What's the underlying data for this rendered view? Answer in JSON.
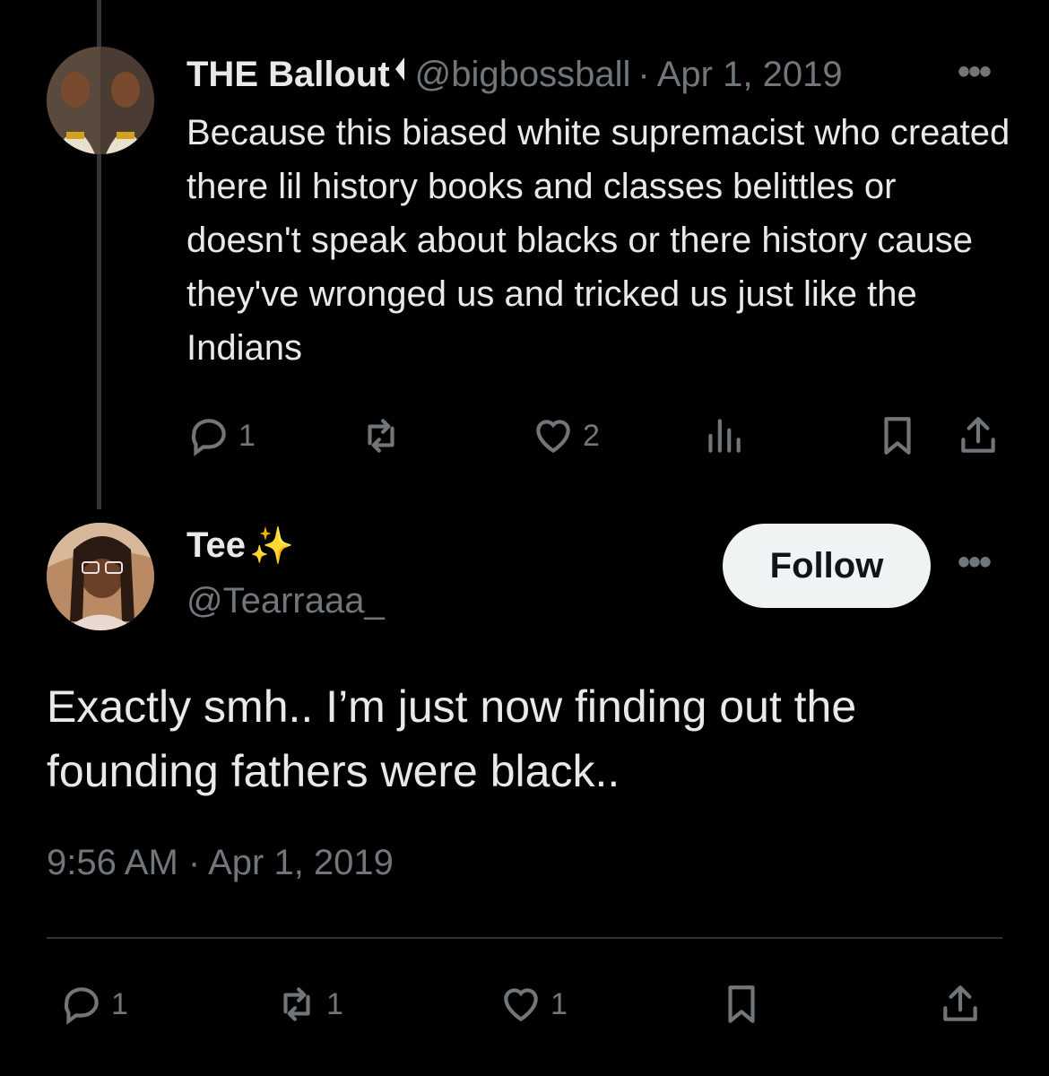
{
  "parent_tweet": {
    "display_name": "THE Ballout",
    "handle": "@bigbossball",
    "separator": "·",
    "date": "Apr 1, 2019",
    "more_label": "•••",
    "text": "Because this biased white supremacist who created there lil history books and classes belittles or doesn't speak about blacks or there history cause they've wronged us and tricked us just like the Indians",
    "actions": {
      "reply_count": "1",
      "repost_count": "",
      "like_count": "2",
      "views_count": ""
    },
    "avatar_icon": "avatar-photo-icon",
    "badge_icon": "flag-badge-icon"
  },
  "reply_tweet": {
    "display_name": "Tee",
    "emoji": "✨",
    "handle": "@Tearraaa_",
    "follow_label": "Follow",
    "more_label": "•••",
    "text": "Exactly smh.. I’m just now finding out the founding fathers were black..",
    "timestamp": "9:56 AM · Apr 1, 2019",
    "actions": {
      "reply_count": "1",
      "repost_count": "1",
      "like_count": "1"
    },
    "avatar_icon": "avatar-photo-icon"
  },
  "colors": {
    "background": "#000000",
    "text": "#e7e9ea",
    "muted": "#71767b",
    "divider": "#2f3336",
    "follow_bg": "#eff3f4"
  }
}
